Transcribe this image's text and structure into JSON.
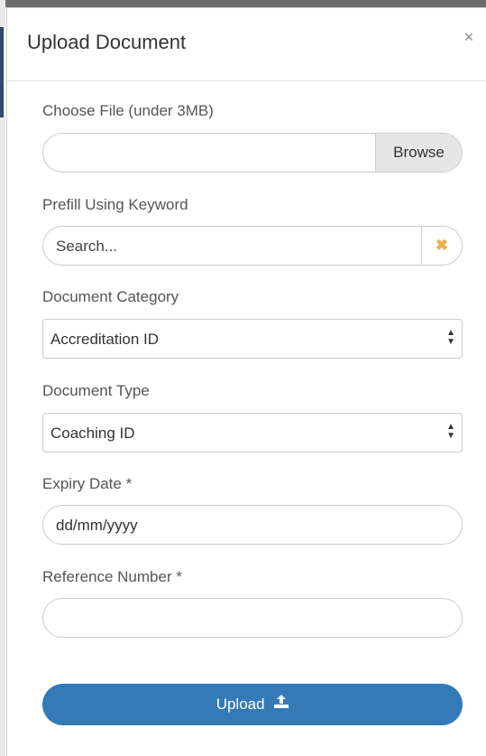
{
  "dialog": {
    "title": "Upload Document",
    "close_glyph": "×"
  },
  "fields": {
    "file": {
      "label": "Choose File (under 3MB)",
      "value": "",
      "browse_label": "Browse"
    },
    "keyword": {
      "label": "Prefill Using Keyword",
      "placeholder": "Search...",
      "clear_glyph": "✖"
    },
    "category": {
      "label": "Document Category",
      "selected": "Accreditation ID"
    },
    "type": {
      "label": "Document Type",
      "selected": "Coaching ID"
    },
    "expiry": {
      "label": "Expiry Date *",
      "placeholder": "dd/mm/yyyy"
    },
    "reference": {
      "label": "Reference Number *",
      "value": ""
    }
  },
  "actions": {
    "upload_label": "Upload",
    "upload_icon": "upload-icon"
  },
  "colors": {
    "primary": "#337ab7",
    "clear_accent": "#f0ad4e"
  }
}
